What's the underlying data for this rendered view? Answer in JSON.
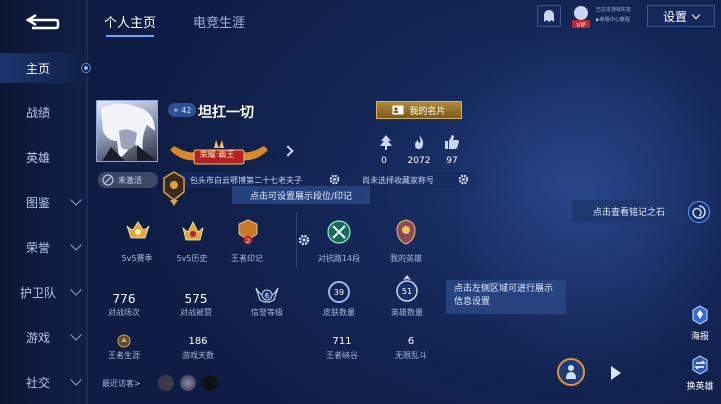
{
  "header": {
    "tabs": [
      {
        "label": "个人主页",
        "active": true
      },
      {
        "label": "电竞生涯",
        "active": false
      }
    ],
    "settings_label": "设置",
    "tiny_status_line1": "已在本游戏实名",
    "tiny_status_line2": "▶新版中心教程"
  },
  "sidebar": {
    "items": [
      {
        "label": "主页",
        "active": true,
        "expandable": false
      },
      {
        "label": "战绩",
        "active": false,
        "expandable": false
      },
      {
        "label": "英雄",
        "active": false,
        "expandable": false
      },
      {
        "label": "图鉴",
        "active": false,
        "expandable": true
      },
      {
        "label": "荣誉",
        "active": false,
        "expandable": true
      },
      {
        "label": "护卫队",
        "active": false,
        "expandable": true
      },
      {
        "label": "游戏",
        "active": false,
        "expandable": true
      },
      {
        "label": "社交",
        "active": false,
        "expandable": true
      }
    ]
  },
  "profile": {
    "level": "42",
    "name": "坦扛一切",
    "card_button": "我的名片",
    "rank_title": "荣耀·霸王",
    "stats": [
      {
        "icon": "like-tree-icon",
        "value": "0"
      },
      {
        "icon": "flame-icon",
        "value": "2072"
      },
      {
        "icon": "thumbs-up-icon",
        "value": "97"
      }
    ],
    "inactive_label": "未激活",
    "location": "包头市白云鄂博第二十七老夫子",
    "collect_title": "尚未选择收藏家称号",
    "rank_tip": "点击可设置展示段位/印记"
  },
  "achievements": [
    {
      "label": "5v5赛季",
      "icon": "gold-wing-badge-icon"
    },
    {
      "label": "5v5历史",
      "icon": "gold-crown-badge-icon"
    },
    {
      "label": "王者印记",
      "icon": "king-mark-icon",
      "badge": "2"
    },
    {
      "label": "对抗路14段",
      "icon": "lane-crossed-swords-icon"
    },
    {
      "label": "我的英雄",
      "icon": "hero-emblem-icon"
    }
  ],
  "stats_grid": {
    "row1": [
      {
        "value": "776",
        "label": "对战场次"
      },
      {
        "value": "575",
        "label": "对战被赞"
      },
      {
        "value": "6",
        "label": "信誉等级",
        "ring": true
      },
      {
        "value": "39",
        "label": "皮肤数量",
        "ring": true
      },
      {
        "value": "51",
        "label": "英雄数量",
        "ring": true
      }
    ],
    "row2": [
      {
        "value": "",
        "label": "王者生涯"
      },
      {
        "value": "186",
        "label": "游戏天数"
      },
      {
        "value": "711",
        "label": "王者峡谷"
      },
      {
        "value": "6",
        "label": "无限乱斗"
      }
    ]
  },
  "tips": {
    "left_area": "点击左侧区域可进行展示信息设置",
    "inscription": "点击查看铭记之石"
  },
  "visitors_label": "最近访客>",
  "right_buttons": {
    "poster": "海报",
    "swap_hero": "换英雄"
  },
  "colors": {
    "accent": "#6aa8ff",
    "gold": "#d9b25a",
    "background": "#14285a"
  }
}
